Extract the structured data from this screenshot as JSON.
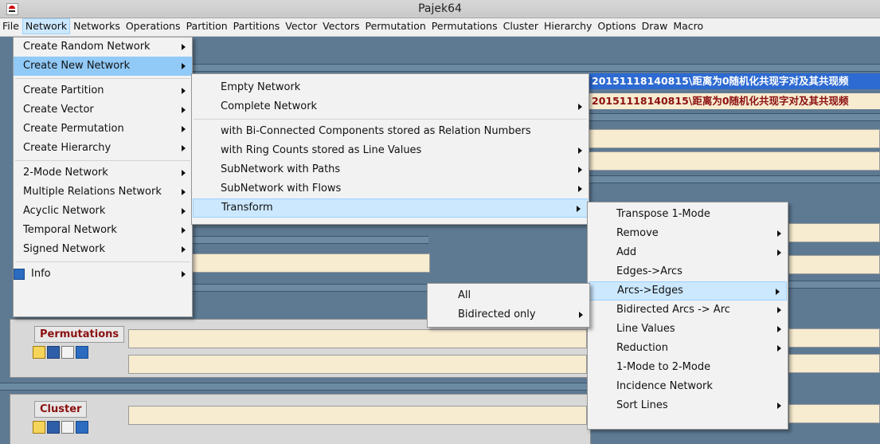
{
  "window": {
    "title": "Pajek64"
  },
  "menubar": [
    "File",
    "Network",
    "Networks",
    "Operations",
    "Partition",
    "Partitions",
    "Vector",
    "Vectors",
    "Permutation",
    "Permutations",
    "Cluster",
    "Hierarchy",
    "Options",
    "Draw",
    "Macro"
  ],
  "network_menu": {
    "items": [
      "Create Random Network",
      "Create New Network",
      "Create Partition",
      "Create Vector",
      "Create Permutation",
      "Create Hierarchy",
      "2-Mode Network",
      "Multiple Relations Network",
      "Acyclic Network",
      "Temporal Network",
      "Signed Network",
      "Info"
    ]
  },
  "create_new_menu": {
    "items": [
      "Empty Network",
      "Complete Network",
      "with Bi-Connected Components stored as Relation Numbers",
      "with Ring Counts stored as Line Values",
      "SubNetwork with Paths",
      "SubNetwork with Flows",
      "Transform"
    ]
  },
  "transform_menu": {
    "items": [
      "Transpose 1-Mode",
      "Remove",
      "Add",
      "Edges->Arcs",
      "Arcs->Edges",
      "Bidirected Arcs -> Arc",
      "Line Values",
      "Reduction",
      "1-Mode to 2-Mode",
      "Incidence Network",
      "Sort Lines"
    ]
  },
  "arcs_edges_menu": {
    "items": [
      "All",
      "Bidirected only"
    ]
  },
  "panels": {
    "permutations_title": "Permutations",
    "cluster_title": "Cluster"
  },
  "fields": {
    "network_line_1": "20151118140815\\距离为0随机化共现字对及其共现频",
    "network_line_2": "20151118140815\\距离为0随机化共现字对及其共现频"
  },
  "colors": {
    "workspace": "#5e7a93",
    "menu_highlight": "#91c9f7",
    "panel_title": "#8b1010"
  }
}
